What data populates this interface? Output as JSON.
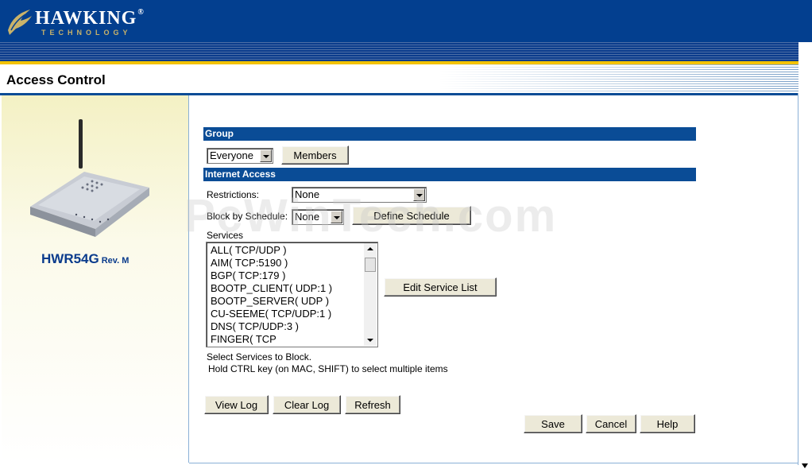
{
  "header": {
    "logo_name": "HAWKING",
    "logo_reg": "®",
    "logo_sub": "TECHNOLOGY"
  },
  "page": {
    "title": "Access Control"
  },
  "device": {
    "model": "HWR54G",
    "revision": "Rev. M"
  },
  "group_section": {
    "title": "Group",
    "group_select": {
      "value": "Everyone"
    },
    "members_button": "Members"
  },
  "internet_access": {
    "title": "Internet Access",
    "restrictions_label": "Restrictions:",
    "restrictions_value": "None",
    "schedule_label": "Block by Schedule:",
    "schedule_value": "None",
    "define_schedule_button": "Define Schedule",
    "services_label": "Services",
    "services": [
      "ALL( TCP/UDP )",
      "AIM( TCP:5190 )",
      "BGP( TCP:179 )",
      "BOOTP_CLIENT( UDP:1 )",
      "BOOTP_SERVER( UDP )",
      "CU-SEEME( TCP/UDP:1 )",
      "DNS( TCP/UDP:3 )",
      "FINGER( TCP"
    ],
    "edit_service_list_button": "Edit Service List",
    "hint_line1": "Select Services to Block.",
    "hint_line2": "Hold CTRL key (on MAC, SHIFT) to select multiple items"
  },
  "log_buttons": {
    "view_log": "View Log",
    "clear_log": "Clear Log",
    "refresh": "Refresh"
  },
  "action_buttons": {
    "save": "Save",
    "cancel": "Cancel",
    "help": "Help"
  },
  "watermark": "PcWinTech.com",
  "colors": {
    "header_blue": "#033f8f",
    "section_bar": "#0a4c96",
    "gold_line": "#f2c200",
    "model_text": "#0a3b8c"
  }
}
